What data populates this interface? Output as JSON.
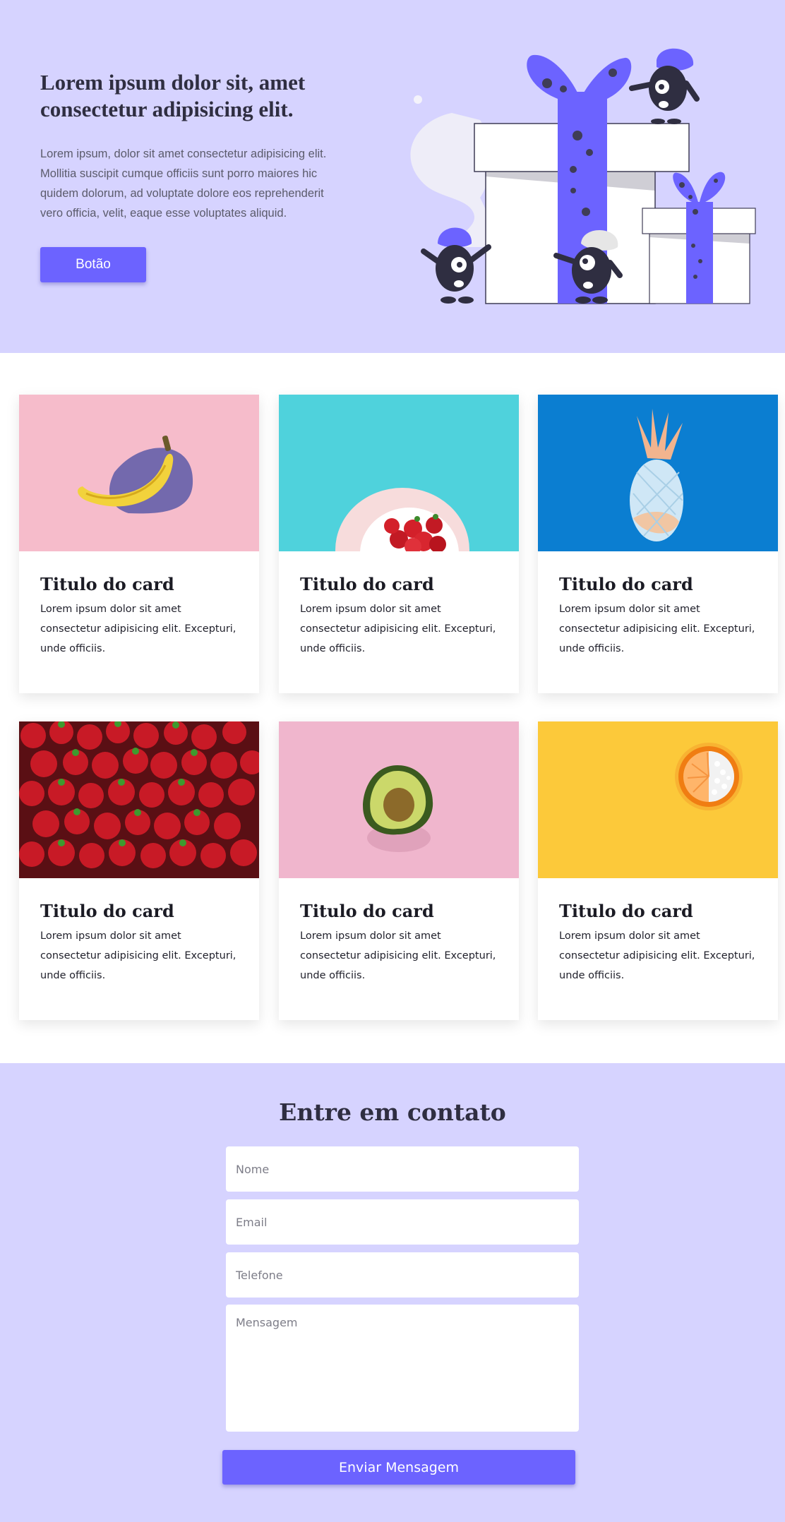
{
  "hero": {
    "title": "Lorem ipsum dolor sit, amet consectetur adipisicing elit.",
    "text": "Lorem ipsum, dolor sit amet consectetur adipisicing elit. Mollitia suscipit cumque officiis sunt porro maiores hic quidem dolorum, ad voluptate dolore eos reprehenderit vero officia, velit, eaque esse voluptates aliquid.",
    "button_label": "Botão",
    "illustration": "gift-boxes-with-monsters-illustration"
  },
  "cards": [
    {
      "title": "Titulo do card",
      "text": "Lorem ipsum dolor sit amet consectetur adipisicing elit. Excepturi, unde officiis.",
      "image": "banana-photo"
    },
    {
      "title": "Titulo do card",
      "text": "Lorem ipsum dolor sit amet consectetur adipisicing elit. Excepturi, unde officiis.",
      "image": "strawberries-on-plate-photo"
    },
    {
      "title": "Titulo do card",
      "text": "Lorem ipsum dolor sit amet consectetur adipisicing elit. Excepturi, unde officiis.",
      "image": "pineapple-photo"
    },
    {
      "title": "Titulo do card",
      "text": "Lorem ipsum dolor sit amet consectetur adipisicing elit. Excepturi, unde officiis.",
      "image": "strawberry-baskets-photo"
    },
    {
      "title": "Titulo do card",
      "text": "Lorem ipsum dolor sit amet consectetur adipisicing elit. Excepturi, unde officiis.",
      "image": "avocado-photo"
    },
    {
      "title": "Titulo do card",
      "text": "Lorem ipsum dolor sit amet consectetur adipisicing elit. Excepturi, unde officiis.",
      "image": "orange-slice-photo"
    }
  ],
  "contact": {
    "title": "Entre em contato",
    "name_placeholder": "Nome",
    "email_placeholder": "Email",
    "phone_placeholder": "Telefone",
    "message_placeholder": "Mensagem",
    "submit_label": "Enviar Mensagem"
  },
  "colors": {
    "accent": "#6c63ff",
    "section_background": "#d6d3ff",
    "dark": "#2f2e41"
  }
}
